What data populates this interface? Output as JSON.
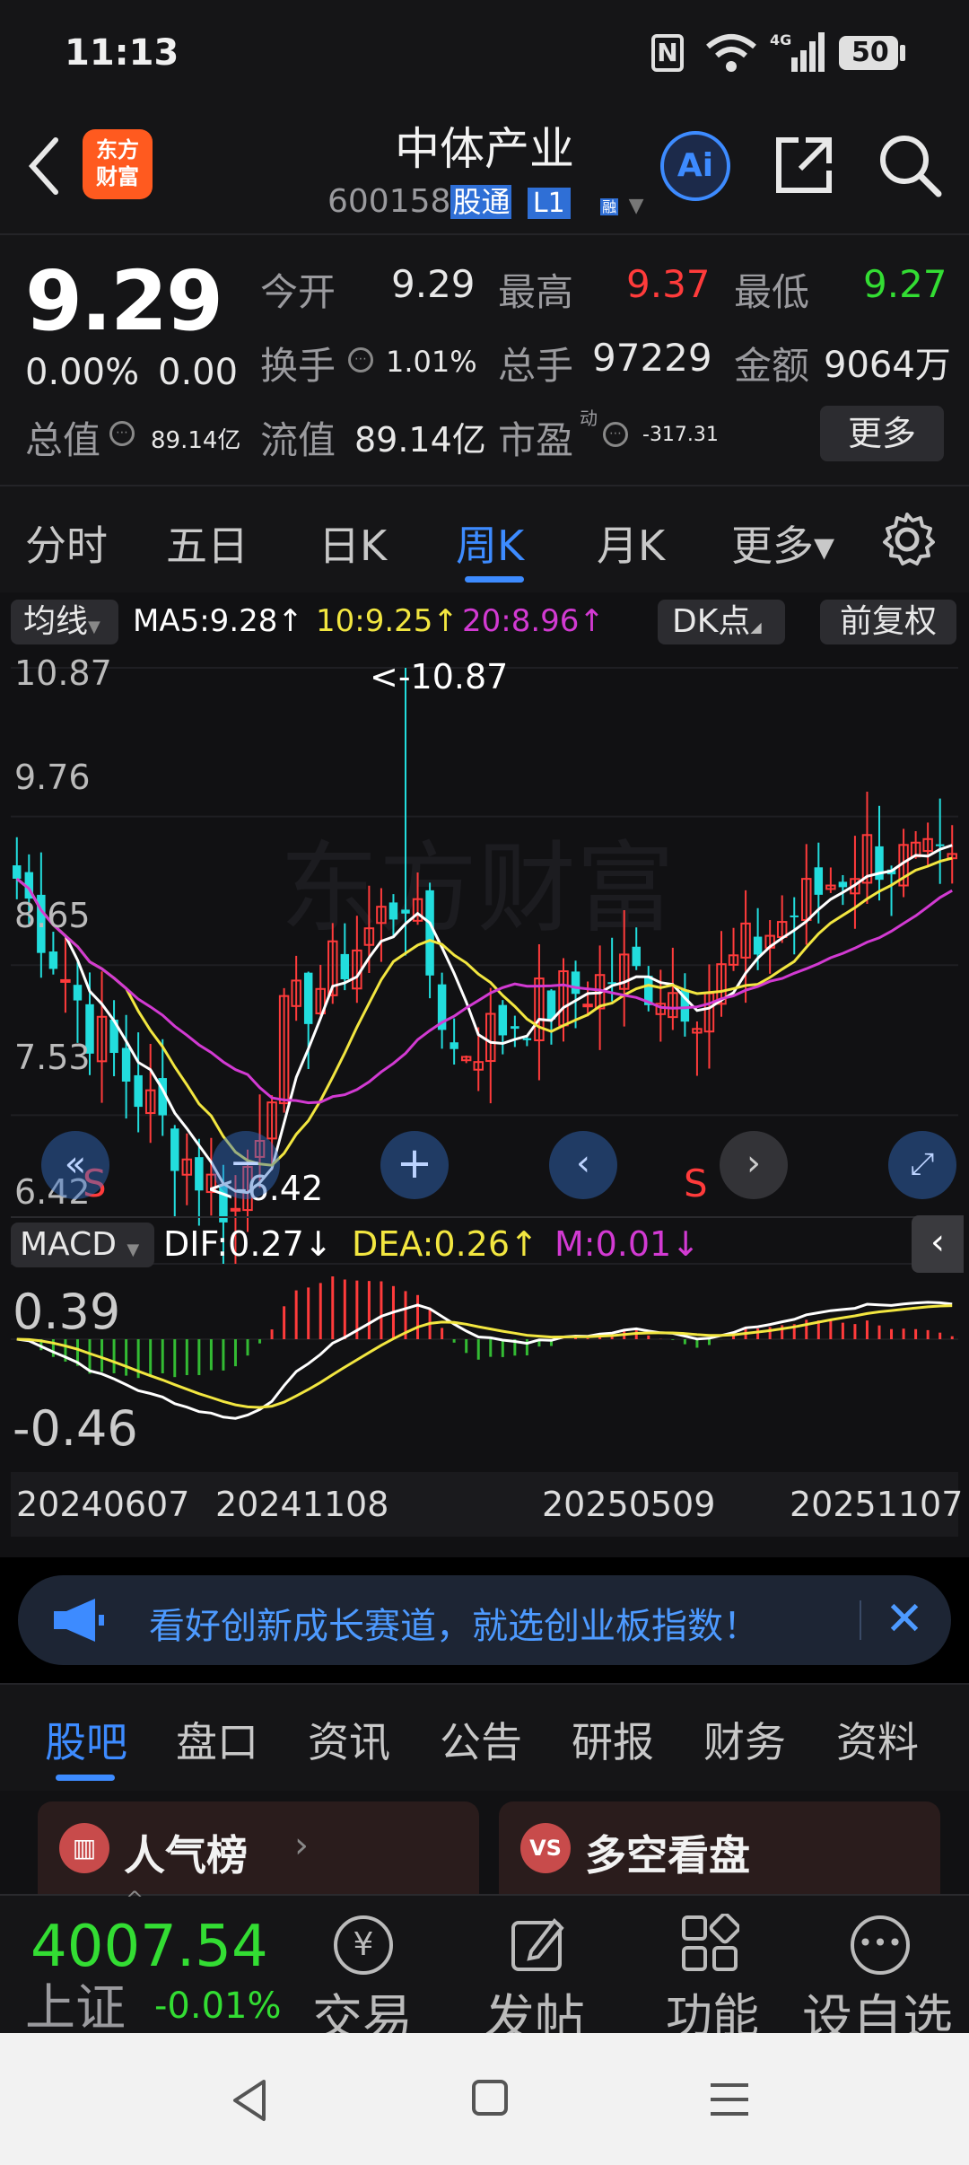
{
  "status": {
    "time": "11:13",
    "battery": "50"
  },
  "header": {
    "logo_text": "东方\n财富",
    "title": "中体产业",
    "code": "600158",
    "tag1": "股通",
    "tag2": "L1",
    "tag3": "融",
    "ai_label": "Ai"
  },
  "quote": {
    "price": "9.29",
    "change_pct": "0.00%",
    "change": "0.00",
    "open_label": "今开",
    "open": "9.29",
    "high_label": "最高",
    "high": "9.37",
    "low_label": "最低",
    "low": "9.27",
    "turnover_label": "换手",
    "turnover": "1.01%",
    "volume_label": "总手",
    "volume": "97229",
    "amount_label": "金额",
    "amount": "9064万",
    "mktcap_label": "总值",
    "mktcap": "89.14亿",
    "float_label": "流值",
    "float": "89.14亿",
    "pe_label": "市盈",
    "pe_sup": "动",
    "pe": "-317.31",
    "more_button": "更多"
  },
  "ktabs": [
    "分时",
    "五日",
    "日K",
    "周K",
    "月K",
    "更多▾"
  ],
  "chart": {
    "ma_button": "均线",
    "ma5": "MA5:9.28↑",
    "ma10": "10:9.25↑",
    "ma20": "20:8.96↑",
    "dk_button": "DK点",
    "adj_button": "前复权",
    "y_top": "10.87",
    "y_2": "9.76",
    "y_3": "8.65",
    "y_4": "7.53",
    "y_bottom": "6.42",
    "max_marker": "<-10.87",
    "min_marker": "<-6.42",
    "s_marker1": "S",
    "s_marker2": "S",
    "macd_button": "MACD",
    "dif": "DIF:0.27↓",
    "dea": "DEA:0.26↑",
    "m": "M:0.01↓",
    "macd_top": "0.39",
    "macd_bottom": "-0.46",
    "dates": [
      "20240607",
      "20241108",
      "20250509",
      "20251107"
    ]
  },
  "banner": {
    "text": "看好创新成长赛道，就选创业板指数！"
  },
  "bottomtabs": [
    "股吧",
    "盘口",
    "资讯",
    "公告",
    "研报",
    "财务",
    "资料"
  ],
  "cards": {
    "card1": "人气榜",
    "card2": "多空看盘"
  },
  "toolbar": {
    "index_value": "4007.54",
    "index_name": "上证",
    "index_change": "-0.01%",
    "trade": "交易",
    "post": "发帖",
    "func": "功能",
    "watch": "设自选"
  },
  "colors": {
    "up": "#ff3b3b",
    "down": "#22dddd",
    "ma5": "#ffffff",
    "ma10": "#f2e640",
    "ma20": "#d23ad2",
    "accent": "#3d8bff"
  }
}
